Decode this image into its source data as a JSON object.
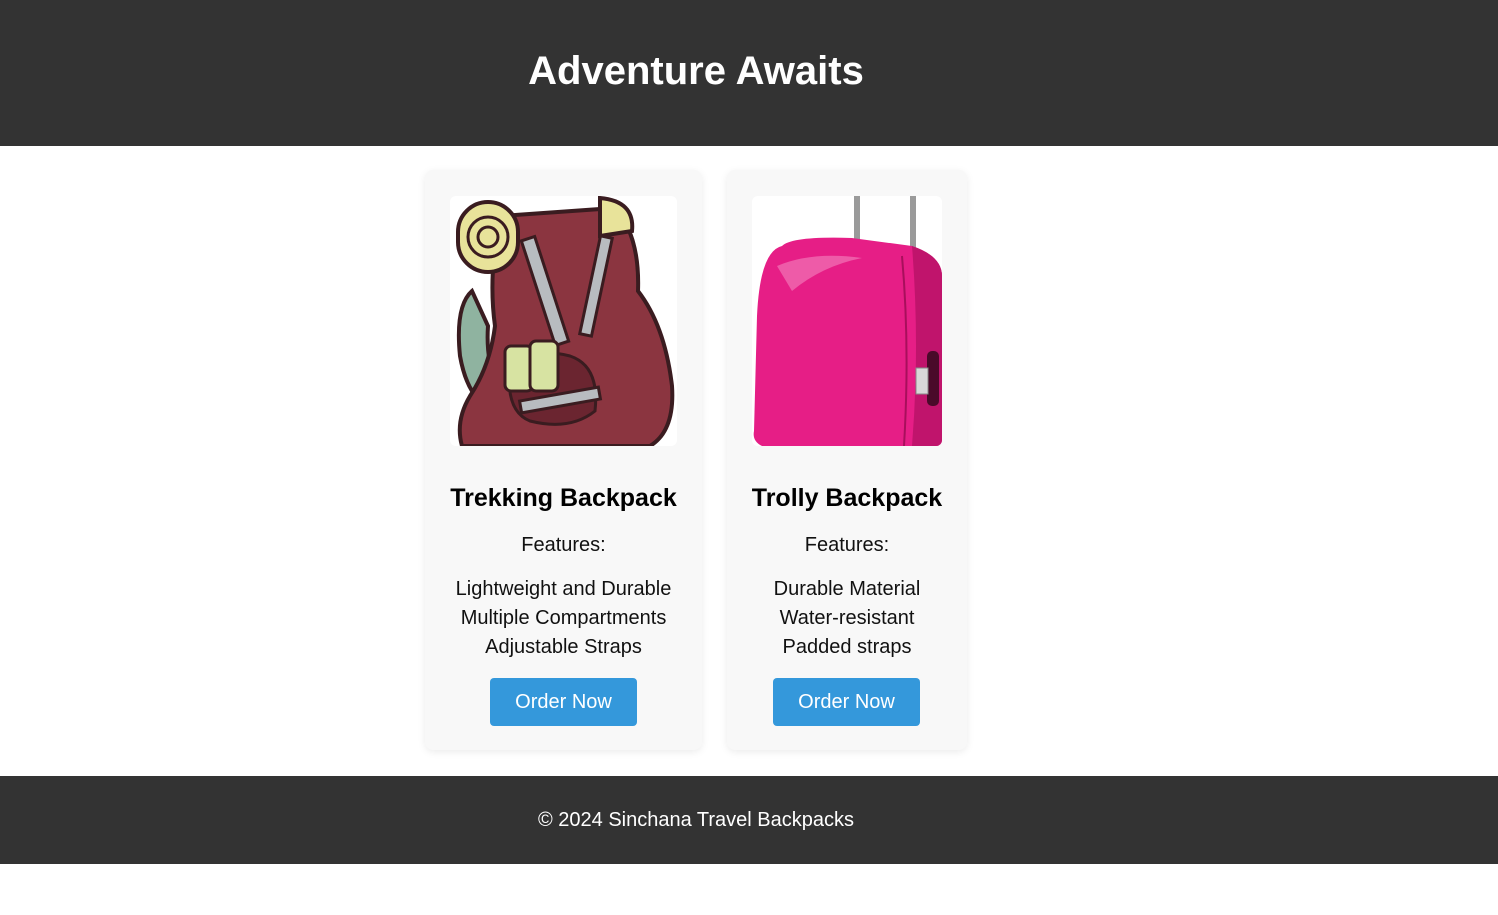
{
  "header": {
    "title": "Adventure Awaits"
  },
  "products": [
    {
      "name": "Trekking Backpack",
      "image_icon": "trekking-backpack-icon",
      "features_label": "Features:",
      "features": [
        "Lightweight and Durable",
        "Multiple Compartments",
        "Adjustable Straps"
      ],
      "button_label": "Order Now"
    },
    {
      "name": "Trolly Backpack",
      "image_icon": "trolley-suitcase-icon",
      "features_label": "Features:",
      "features": [
        "Durable Material",
        "Water-resistant",
        "Padded straps"
      ],
      "button_label": "Order Now"
    }
  ],
  "footer": {
    "copyright": "© 2024 Sinchana Travel Backpacks"
  },
  "colors": {
    "header_bg": "#333333",
    "card_bg": "#f8f8f8",
    "button_bg": "#3498db",
    "backpack_main": "#8b3540",
    "bedroll": "#e8e39a",
    "suitcase": "#e61e86"
  }
}
